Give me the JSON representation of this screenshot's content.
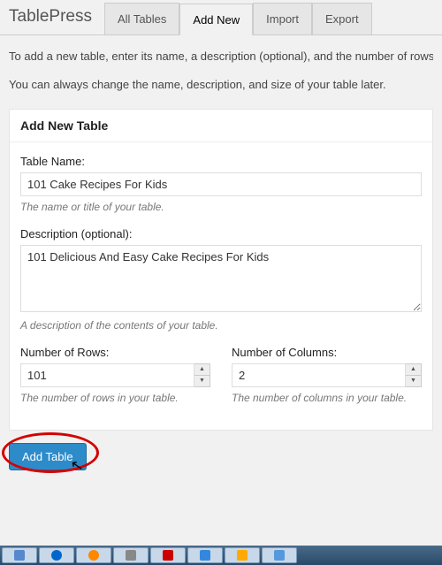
{
  "header": {
    "brand": "TablePress",
    "tabs": [
      {
        "label": "All Tables",
        "active": false
      },
      {
        "label": "Add New",
        "active": true
      },
      {
        "label": "Import",
        "active": false
      },
      {
        "label": "Export",
        "active": false
      }
    ]
  },
  "intro": {
    "line1": "To add a new table, enter its name, a description (optional), and the number of rows",
    "line2": "You can always change the name, description, and size of your table later."
  },
  "panel": {
    "title": "Add New Table",
    "name": {
      "label": "Table Name:",
      "value": "101 Cake Recipes For Kids",
      "help": "The name or title of your table."
    },
    "description": {
      "label": "Description (optional):",
      "value": "101 Delicious And Easy Cake Recipes For Kids",
      "help": "A description of the contents of your table."
    },
    "rows": {
      "label": "Number of Rows:",
      "value": "101",
      "help": "The number of rows in your table."
    },
    "cols": {
      "label": "Number of Columns:",
      "value": "2",
      "help": "The number of columns in your table."
    }
  },
  "submit": {
    "button": "Add Table"
  }
}
